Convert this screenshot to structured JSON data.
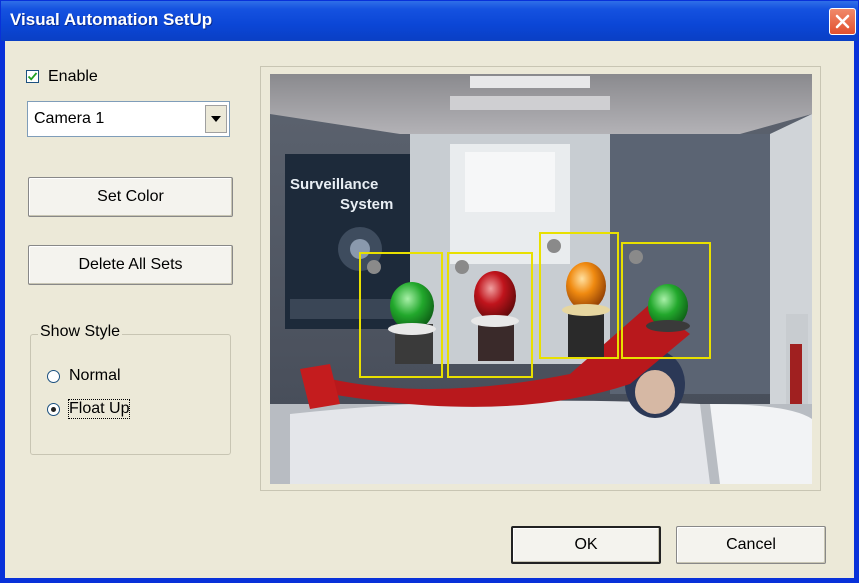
{
  "window": {
    "title": "Visual Automation SetUp",
    "close_icon": "close-icon",
    "title_bar_color": "#0b46d6"
  },
  "enable": {
    "label": "Enable",
    "checked": true
  },
  "camera_select": {
    "value": "Camera 1"
  },
  "buttons": {
    "set_color": "Set Color",
    "delete_all": "Delete All Sets",
    "ok": "OK",
    "cancel": "Cancel"
  },
  "show_style": {
    "title": "Show Style",
    "options": [
      {
        "label": "Normal",
        "selected": false
      },
      {
        "label": "Float Up",
        "selected": true
      }
    ]
  },
  "preview": {
    "poster_title": "Surveillance System",
    "highlight_color": "#e8e000"
  }
}
